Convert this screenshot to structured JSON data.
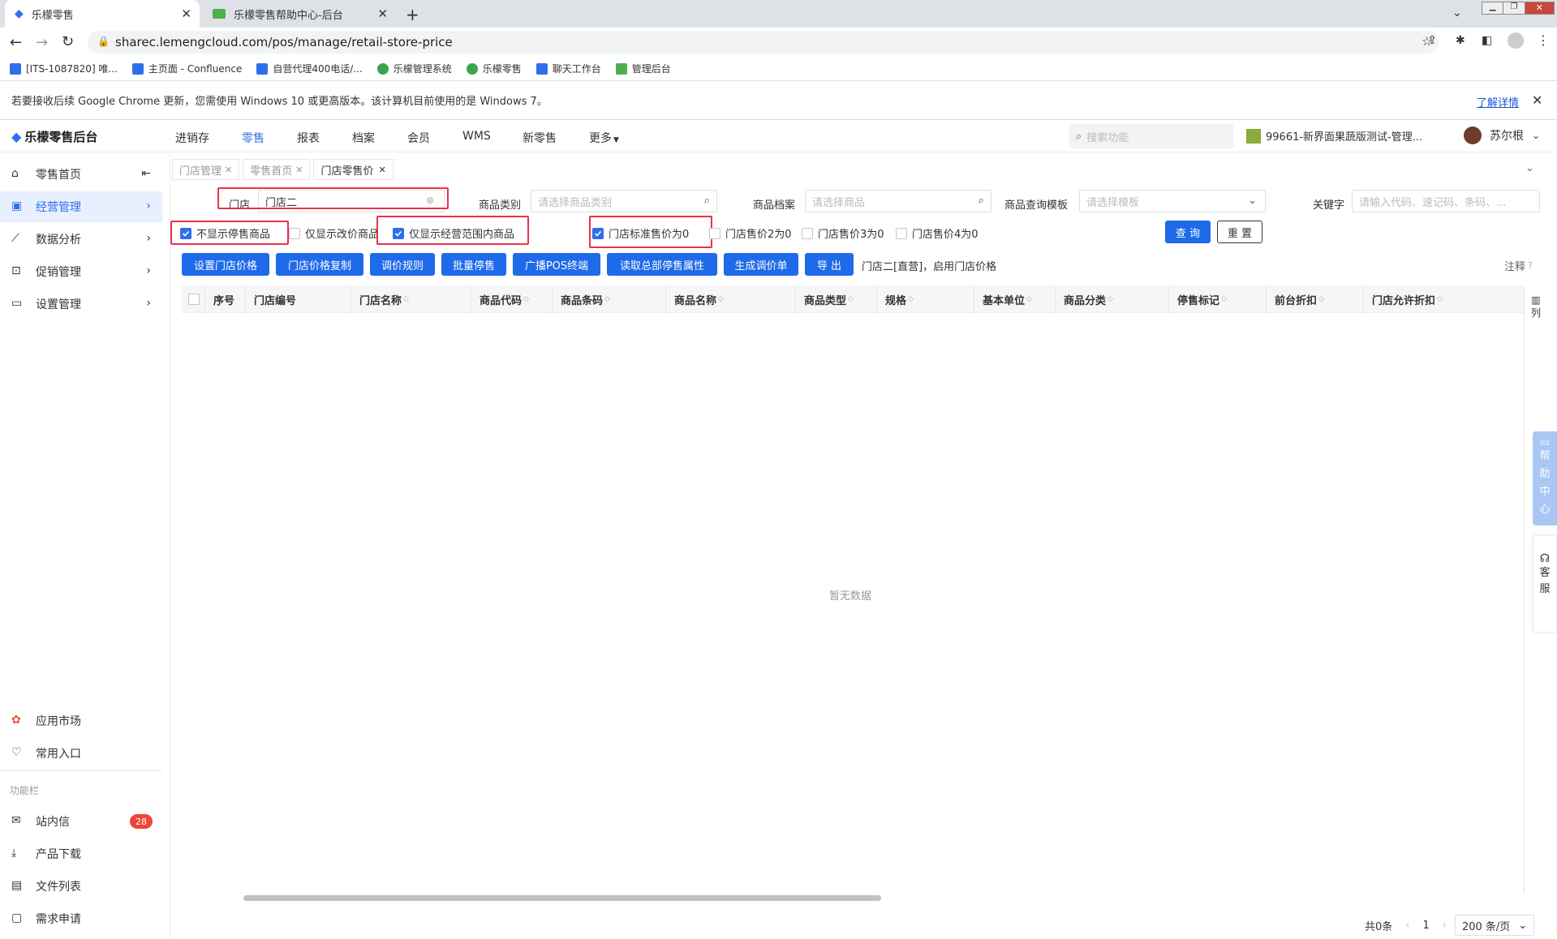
{
  "browser": {
    "tabs": [
      {
        "title": "乐檬零售"
      },
      {
        "title": "乐檬零售帮助中心-后台"
      }
    ],
    "url": "sharec.lemengcloud.com/pos/manage/retail-store-price",
    "bookmarks": [
      "[ITS-1087820] 唯...",
      "主页面 - Confluence",
      "自营代理400电话/...",
      "乐檬管理系统",
      "乐檬零售",
      "聊天工作台",
      "管理后台"
    ],
    "infobar_text": "若要接收后续 Google Chrome 更新，您需使用 Windows 10 或更高版本。该计算机目前使用的是 Windows 7。",
    "infobar_link": "了解详情"
  },
  "app": {
    "logo": "乐檬零售后台",
    "nav": [
      "进销存",
      "零售",
      "报表",
      "档案",
      "会员",
      "WMS",
      "新零售",
      "更多"
    ],
    "search_placeholder": "搜索功能",
    "store_name": "99661-新界面果蔬版测试-管理...",
    "user_name": "苏尔根"
  },
  "sidebar": {
    "items": [
      "零售首页",
      "经营管理",
      "数据分析",
      "促销管理",
      "设置管理"
    ],
    "bottom": [
      "应用市场",
      "常用入口"
    ],
    "section": "功能栏",
    "tools": [
      "站内信",
      "产品下载",
      "文件列表",
      "需求申请"
    ],
    "message_count": "28"
  },
  "page_tabs": [
    "门店管理",
    "零售首页",
    "门店零售价"
  ],
  "filters": {
    "store_label": "门店",
    "store_value": "门店二",
    "category_label": "商品类别",
    "category_placeholder": "请选择商品类别",
    "archive_label": "商品档案",
    "archive_placeholder": "请选择商品",
    "template_label": "商品查询模板",
    "template_placeholder": "请选择模板",
    "keyword_label": "关键字",
    "keyword_placeholder": "请输入代码、速记码、条码、..."
  },
  "checkboxes": [
    {
      "label": "不显示停售商品",
      "checked": true
    },
    {
      "label": "仅显示改价商品",
      "checked": false
    },
    {
      "label": "仅显示经营范围内商品",
      "checked": true
    },
    {
      "label": "门店标准售价为0",
      "checked": true
    },
    {
      "label": "门店售价2为0",
      "checked": false
    },
    {
      "label": "门店售价3为0",
      "checked": false
    },
    {
      "label": "门店售价4为0",
      "checked": false
    }
  ],
  "query_button": "查 询",
  "reset_button": "重 置",
  "actions": [
    "设置门店价格",
    "门店价格复制",
    "调价规则",
    "批量停售",
    "广播POS终端",
    "读取总部停售属性",
    "生成调价单",
    "导 出"
  ],
  "action_note": "门店二[直营]，启用门店价格",
  "note_label": "注释",
  "columns": [
    "序号",
    "门店编号",
    "门店名称",
    "商品代码",
    "商品条码",
    "商品名称",
    "商品类型",
    "规格",
    "基本单位",
    "商品分类",
    "停售标记",
    "前台折扣",
    "门店允许折扣"
  ],
  "column_toggle": "列",
  "empty_text": "暂无数据",
  "pagination": {
    "total": "共0条",
    "page": "1",
    "size": "200 条/页"
  },
  "float_help": "帮助中心",
  "float_service": "客服",
  "colors": {
    "primary": "#1f6ae8",
    "highlight": "#e8334a"
  }
}
